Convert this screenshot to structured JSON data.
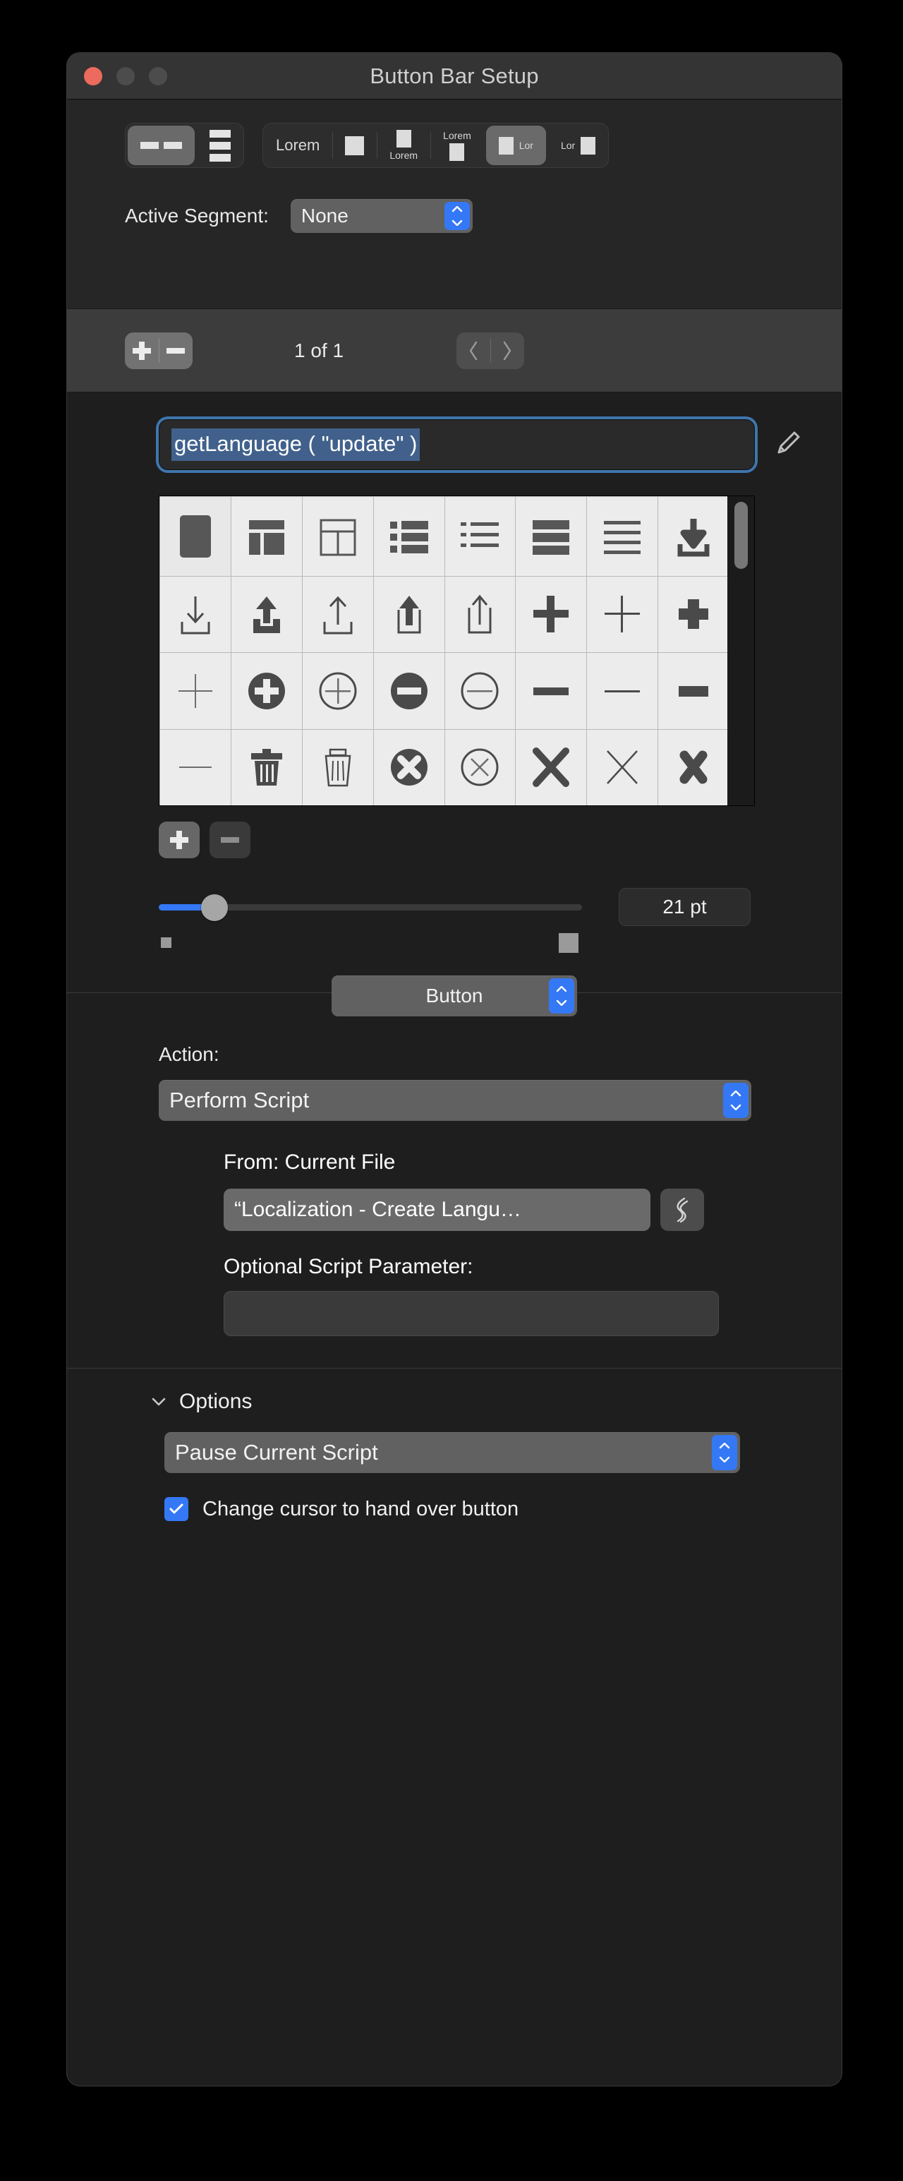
{
  "window": {
    "title": "Button Bar Setup",
    "traffic_lights": [
      "close",
      "minimize",
      "zoom"
    ]
  },
  "style_toolbar": {
    "layout_options": [
      {
        "name": "horizontal-dashes",
        "selected": true
      },
      {
        "name": "vertical-rows",
        "selected": false
      }
    ],
    "display_options": [
      {
        "name": "text-only",
        "label": "Lorem",
        "selected": false
      },
      {
        "name": "icon-only",
        "label": "",
        "selected": false
      },
      {
        "name": "icon-above-text",
        "label": "Lorem",
        "selected": false
      },
      {
        "name": "text-above-icon",
        "label": "Lorem",
        "selected": false
      },
      {
        "name": "icon-left-text",
        "label": "Lor",
        "selected": true
      },
      {
        "name": "text-left-icon",
        "label": "Lor",
        "selected": false
      }
    ]
  },
  "active_segment": {
    "label": "Active Segment:",
    "value": "None"
  },
  "paging": {
    "add_label": "+",
    "remove_label": "—",
    "counter": "1 of 1",
    "prev_label": "‹",
    "next_label": "›"
  },
  "segment_editor": {
    "label_field_value": "getLanguage ( \"update\" )",
    "edit_icon": "pencil-icon",
    "icon_grid": [
      [
        "filled-square",
        "layout-sidebar",
        "layout-columns",
        "bullet-list",
        "dashed-list",
        "striped-bars",
        "stacked-lines",
        "download-tray"
      ],
      [
        "download-arrow-thin",
        "upload-tray-filled",
        "upload-arrow-thin",
        "export-box-filled",
        "export-box-thin",
        "plus-thick",
        "plus-thin",
        "plus-bold"
      ],
      [
        "plus-light",
        "plus-circle-filled",
        "plus-circle-outline",
        "minus-circle-filled",
        "minus-circle-outline",
        "minus-thick",
        "minus-thin",
        "minus-bold"
      ],
      [
        "minus-light",
        "trash-filled",
        "trash-outline",
        "x-circle-filled",
        "x-circle-outline",
        "x-thick",
        "x-thin",
        "x-bold"
      ]
    ],
    "selected_icon_index": 0,
    "add_icon_label": "+",
    "remove_icon_label": "—",
    "size_value": "21 pt",
    "size_percent": 13
  },
  "type_popup": {
    "value": "Button"
  },
  "action": {
    "label": "Action:",
    "value": "Perform Script",
    "from_line": "From: Current File",
    "script_value": "“Localization - Create Langu…",
    "specify_icon": "script-specify-icon",
    "parameter_label": "Optional Script Parameter:",
    "parameter_value": "",
    "parameter_placeholder": ""
  },
  "options": {
    "title": "Options",
    "disclosure": "chevron-down-icon",
    "pause_value": "Pause Current Script",
    "cursor_checkbox_label": "Change cursor to hand over button",
    "cursor_checkbox_checked": true
  },
  "colors": {
    "accent": "#3478f6",
    "window_bg": "#1e1e1e",
    "section_bg": "#262626",
    "paging_bg": "#3c3c3c",
    "selection": "#41618c"
  }
}
